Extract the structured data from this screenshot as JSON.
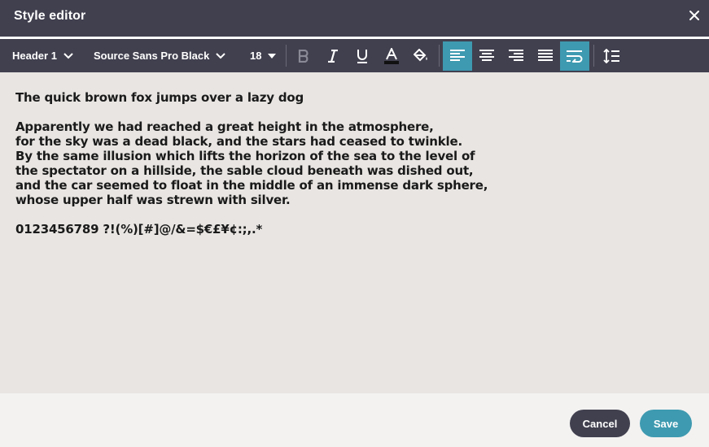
{
  "window": {
    "title": "Style editor"
  },
  "toolbar": {
    "style_select": "Header 1",
    "font_select": "Source Sans Pro Black",
    "size_select": "18",
    "buttons": [
      {
        "name": "bold",
        "icon": "bold-icon",
        "active": false
      },
      {
        "name": "italic",
        "icon": "italic-icon",
        "active": false
      },
      {
        "name": "underline",
        "icon": "underline-icon",
        "active": false
      },
      {
        "name": "text-color",
        "icon": "text-color-icon",
        "active": false
      },
      {
        "name": "fill-color",
        "icon": "paint-bucket-icon",
        "active": false
      },
      {
        "name": "align-left",
        "icon": "align-left-icon",
        "active": true
      },
      {
        "name": "align-center",
        "icon": "align-center-icon",
        "active": false
      },
      {
        "name": "align-right",
        "icon": "align-right-icon",
        "active": false
      },
      {
        "name": "align-justify",
        "icon": "align-justify-icon",
        "active": false
      },
      {
        "name": "wrap-text",
        "icon": "wrap-text-icon",
        "active": true
      },
      {
        "name": "line-height",
        "icon": "line-height-icon",
        "active": false
      }
    ]
  },
  "editor": {
    "heading": "The quick brown fox jumps over a lazy dog",
    "paragraph_lines": [
      "Apparently we had reached a great height in the atmosphere,",
      "for the sky was a dead black, and the stars had ceased to twinkle.",
      "By the same illusion which lifts the horizon of the sea to the level of",
      "the spectator on a hillside, the sable cloud beneath was dished out,",
      "and the car seemed to float in the middle of an immense dark sphere,",
      "whose upper half was strewn with silver."
    ],
    "symbols": "0123456789 ?!(%)[#]@/&=$€£¥¢:;,.*"
  },
  "footer": {
    "cancel_label": "Cancel",
    "save_label": "Save"
  },
  "colors": {
    "header": "#41404f",
    "accent": "#3e9ab0",
    "editor_bg": "#e8e5e2"
  }
}
